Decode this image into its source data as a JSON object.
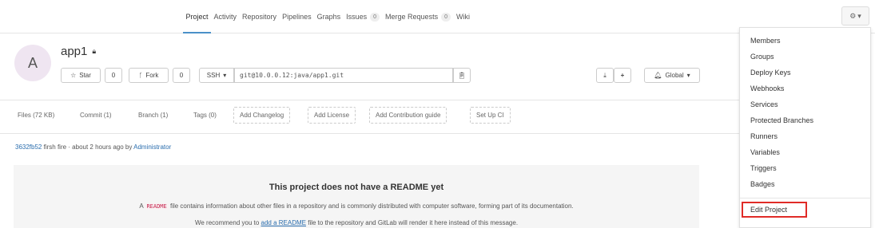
{
  "nav": {
    "tabs": [
      "Project",
      "Activity",
      "Repository",
      "Pipelines",
      "Graphs"
    ],
    "issues_label": "Issues",
    "issues_count": "0",
    "mr_label": "Merge Requests",
    "mr_count": "0",
    "wiki_label": "Wiki",
    "active_tab": "Project"
  },
  "project": {
    "avatar_letter": "A",
    "name": "app1",
    "star_label": "Star",
    "star_count": "0",
    "fork_label": "Fork",
    "fork_count": "0",
    "protocol": "SSH",
    "clone_url": "git@10.0.0.12:java/app1.git",
    "notification_label": "Global"
  },
  "stats": {
    "files": "Files (72 KB)",
    "commit": "Commit (1)",
    "branch": "Branch (1)",
    "tags": "Tags (0)",
    "add_changelog": "Add Changelog",
    "add_license": "Add License",
    "add_contribution": "Add Contribution guide",
    "setup_ci": "Set Up CI"
  },
  "commit": {
    "sha": "3632fb52",
    "message": "firsh fire · about 2 hours ago by",
    "author": "Administrator"
  },
  "readme": {
    "title": "This project does not have a README yet",
    "p1_pre": "A",
    "p1_code": "README",
    "p1_post": "file contains information about other files in a repository and is commonly distributed with computer software, forming part of its documentation.",
    "p2_pre": "We recommend you to",
    "p2_link": "add a README",
    "p2_post": "file to the repository and GitLab will render it here instead of this message."
  },
  "settings_menu": {
    "items": [
      "Members",
      "Groups",
      "Deploy Keys",
      "Webhooks",
      "Services",
      "Protected Branches",
      "Runners",
      "Variables",
      "Triggers",
      "Badges"
    ],
    "edit_project": "Edit Project"
  },
  "colors": {
    "accent": "#4a90c8",
    "link": "#2b6eae",
    "highlight_border": "#e02b27"
  }
}
